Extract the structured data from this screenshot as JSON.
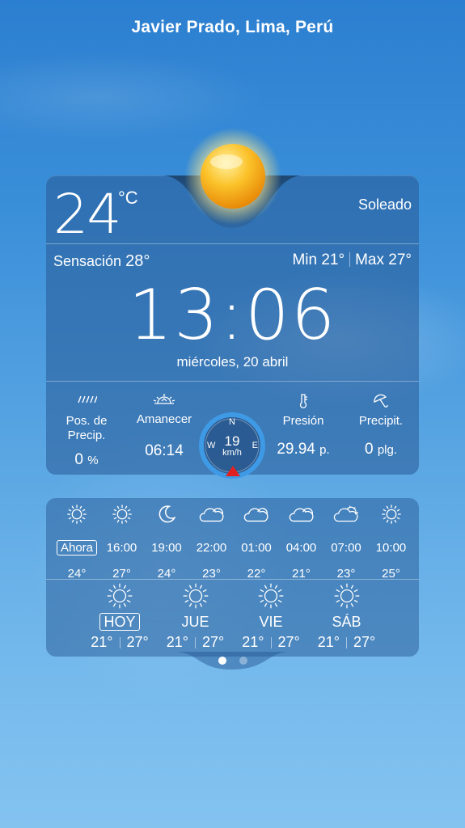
{
  "location": "Javier Prado, Lima, Perú",
  "current": {
    "temp": "24",
    "unit": "°C",
    "condition": "Soleado",
    "feels_label": "Sensación",
    "feels_value": "28°",
    "min_label": "Min",
    "min_value": "21°",
    "max_label": "Max",
    "max_value": "27°",
    "time": "13:06",
    "date": "miércoles, 20 abril"
  },
  "stats": {
    "precip_prob": {
      "label": "Pos. de Precip.",
      "value": "0",
      "unit": "%",
      "icon": "rain-icon"
    },
    "sunrise": {
      "label": "Amanecer",
      "value": "06:14",
      "icon": "sunrise-icon"
    },
    "wind": {
      "speed": "19",
      "unit": "km/h",
      "n": "N",
      "e": "E",
      "w": "W",
      "icon": "compass-icon"
    },
    "pressure": {
      "label": "Presión",
      "value": "29.94",
      "unit": "p.",
      "icon": "thermometer-icon"
    },
    "precip": {
      "label": "Precipit.",
      "value": "0",
      "unit": "plg.",
      "icon": "umbrella-icon"
    }
  },
  "hourly": [
    {
      "time": "Ahora",
      "temp": "24°",
      "icon": "sun-icon"
    },
    {
      "time": "16:00",
      "temp": "27°",
      "icon": "sun-icon"
    },
    {
      "time": "19:00",
      "temp": "24°",
      "icon": "moon-icon"
    },
    {
      "time": "22:00",
      "temp": "23°",
      "icon": "cloud-icon"
    },
    {
      "time": "01:00",
      "temp": "22°",
      "icon": "cloud-icon"
    },
    {
      "time": "04:00",
      "temp": "21°",
      "icon": "cloud-icon"
    },
    {
      "time": "07:00",
      "temp": "23°",
      "icon": "cloud-sun-icon"
    },
    {
      "time": "10:00",
      "temp": "25°",
      "icon": "sun-icon"
    }
  ],
  "daily": [
    {
      "day": "HOY",
      "min": "21°",
      "max": "27°",
      "icon": "sun-icon"
    },
    {
      "day": "JUE",
      "min": "21°",
      "max": "27°",
      "icon": "sun-icon"
    },
    {
      "day": "VIE",
      "min": "21°",
      "max": "27°",
      "icon": "sun-icon"
    },
    {
      "day": "SÁB",
      "min": "21°",
      "max": "27°",
      "icon": "sun-icon"
    }
  ],
  "colors": {
    "compass_ring": "#3f9ae6",
    "wind_arrow": "#e32020",
    "sun": "#f7b416"
  }
}
